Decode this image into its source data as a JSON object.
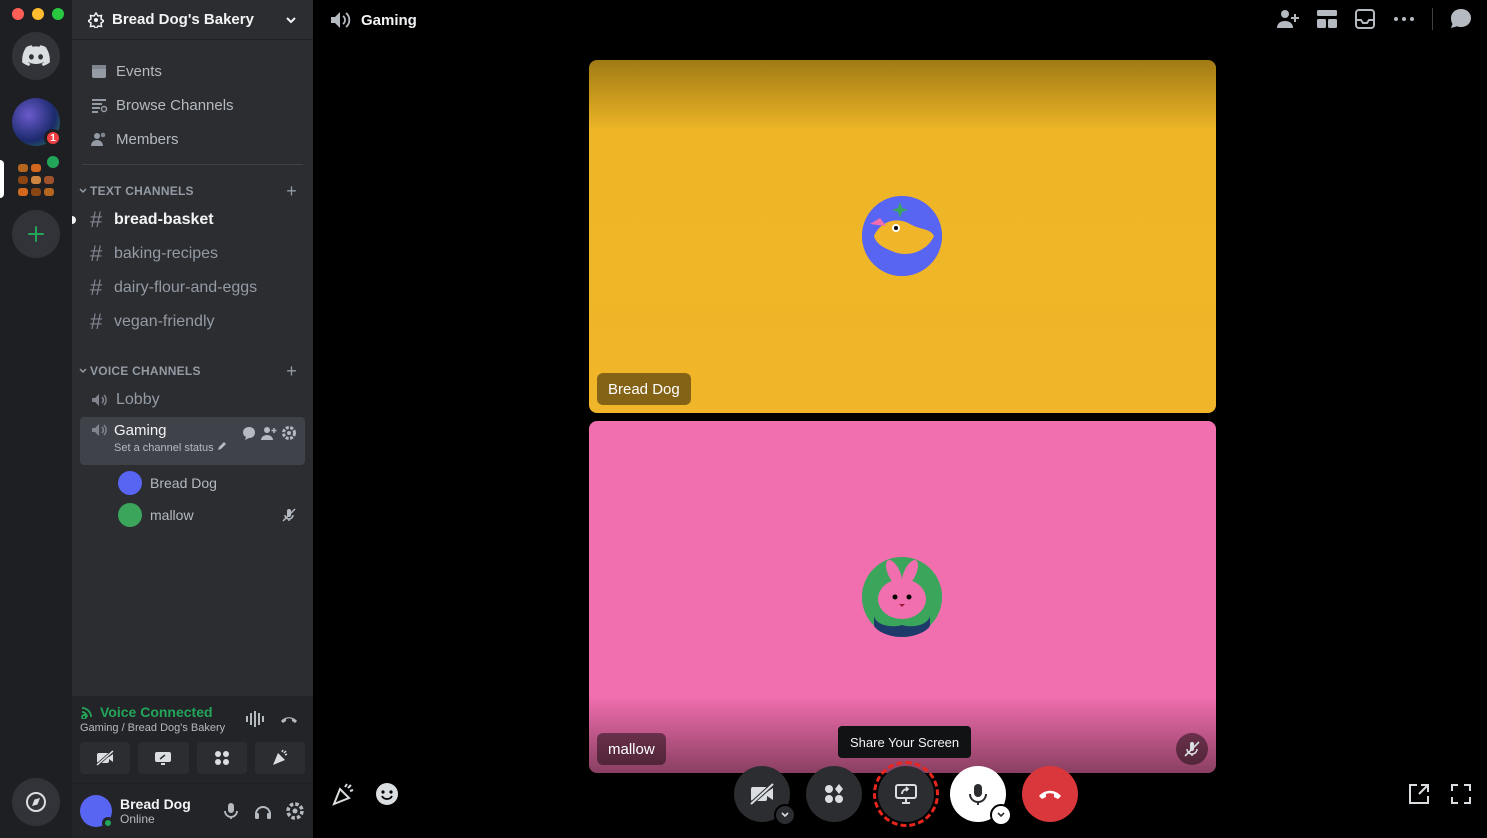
{
  "server": {
    "name": "Bread Dog's Bakery"
  },
  "rail": {
    "unread_badge": "1"
  },
  "nav": [
    {
      "label": "Events"
    },
    {
      "label": "Browse Channels"
    },
    {
      "label": "Members"
    }
  ],
  "text_category": {
    "label": "Text Channels"
  },
  "text_channels": [
    {
      "name": "bread-basket"
    },
    {
      "name": "baking-recipes"
    },
    {
      "name": "dairy-flour-and-eggs"
    },
    {
      "name": "vegan-friendly"
    }
  ],
  "voice_category": {
    "label": "Voice Channels"
  },
  "voice_channels": [
    {
      "name": "Lobby"
    },
    {
      "name": "Gaming",
      "status_placeholder": "Set a channel status"
    }
  ],
  "members": [
    {
      "name": "Bread Dog"
    },
    {
      "name": "mallow"
    }
  ],
  "voice_panel": {
    "title": "Voice Connected",
    "subtitle": "Gaming / Bread Dog's Bakery"
  },
  "user": {
    "name": "Bread Dog",
    "status": "Online"
  },
  "main": {
    "channel_title": "Gaming",
    "tooltip": "Share Your Screen"
  },
  "tiles": [
    {
      "name": "Bread Dog"
    },
    {
      "name": "mallow"
    }
  ],
  "colors": {
    "accent": "#5865f2",
    "online": "#23a55a",
    "danger": "#da373c",
    "tile_yellow": "#f0b528",
    "tile_pink": "#f26faf"
  }
}
